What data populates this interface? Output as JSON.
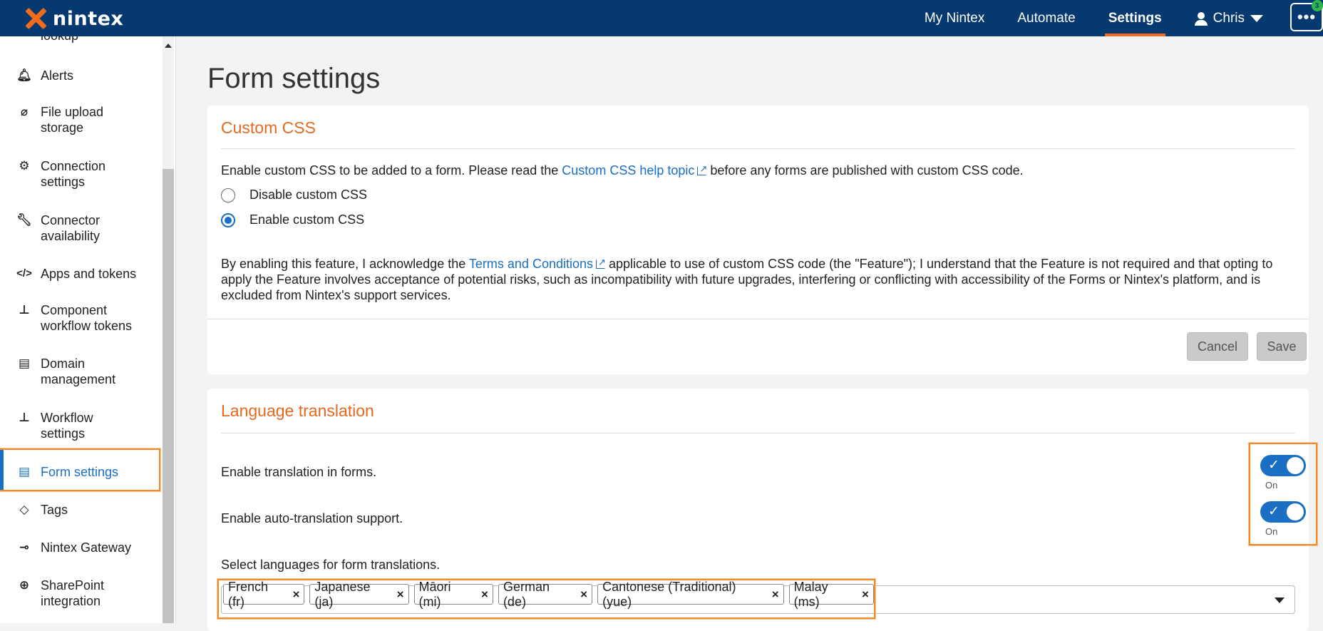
{
  "app": {
    "brand": "nintex",
    "accent_color": "#f26b1d",
    "header_color": "#063970",
    "link_color": "#1a6fc4"
  },
  "topnav": {
    "items": [
      {
        "label": "My Nintex"
      },
      {
        "label": "Automate"
      },
      {
        "label": "Settings",
        "active": true
      }
    ],
    "user_name": "Chris",
    "more_label": "•••",
    "notification_count": "3"
  },
  "sidebar": {
    "items": [
      {
        "label_lines": [
          "lookup"
        ],
        "icon": "book-icon"
      },
      {
        "label_lines": [
          "Alerts"
        ],
        "icon": "bell-icon"
      },
      {
        "label_lines": [
          "File upload",
          "storage"
        ],
        "icon": "paperclip-icon"
      },
      {
        "label_lines": [
          "Connection",
          "settings"
        ],
        "icon": "gears-icon"
      },
      {
        "label_lines": [
          "Connector",
          "availability"
        ],
        "icon": "wrench-icon"
      },
      {
        "label_lines": [
          "Apps and tokens"
        ],
        "icon": "code-icon"
      },
      {
        "label_lines": [
          "Component",
          "workflow tokens"
        ],
        "icon": "hierarchy-icon"
      },
      {
        "label_lines": [
          "Domain",
          "management"
        ],
        "icon": "domain-settings-icon"
      },
      {
        "label_lines": [
          "Workflow",
          "settings"
        ],
        "icon": "workflow-icon"
      },
      {
        "label_lines": [
          "Form settings"
        ],
        "icon": "form-settings-icon",
        "active": true
      },
      {
        "label_lines": [
          "Tags"
        ],
        "icon": "tag-icon"
      },
      {
        "label_lines": [
          "Nintex Gateway"
        ],
        "icon": "gateway-icon"
      },
      {
        "label_lines": [
          "SharePoint",
          "integration"
        ],
        "icon": "sharepoint-icon"
      }
    ]
  },
  "page": {
    "title": "Form settings"
  },
  "custom_css": {
    "title": "Custom CSS",
    "intro_before": "Enable custom CSS to be added to a form. Please read the ",
    "intro_link": "Custom CSS help topic",
    "intro_after": " before any forms are published with custom CSS code.",
    "options": [
      {
        "label": "Disable custom CSS",
        "checked": false
      },
      {
        "label": "Enable custom CSS",
        "checked": true
      }
    ],
    "terms_before": "By enabling this feature, I acknowledge the ",
    "terms_link": "Terms and Conditions",
    "terms_after": " applicable to use of custom CSS code (the \"Feature\"); I understand that the Feature is not required and that opting to apply the Feature involves acceptance of potential risks, such as incompatibility with future upgrades, interfering or conflicting with accessibility of the Forms or Nintex's platform, and is excluded from Nintex's support services.",
    "cancel_label": "Cancel",
    "save_label": "Save"
  },
  "language": {
    "title": "Language translation",
    "enable_translation_label": "Enable translation in forms.",
    "enable_translation_state": "On",
    "auto_translation_label": "Enable auto-translation support.",
    "auto_translation_state": "On",
    "select_label": "Select languages for form translations.",
    "selected_languages": [
      "French (fr)",
      "Japanese (ja)",
      "Māori (mi)",
      "German (de)",
      "Cantonese (Traditional) (yue)",
      "Malay (ms)"
    ],
    "remove_glyph": "×"
  }
}
